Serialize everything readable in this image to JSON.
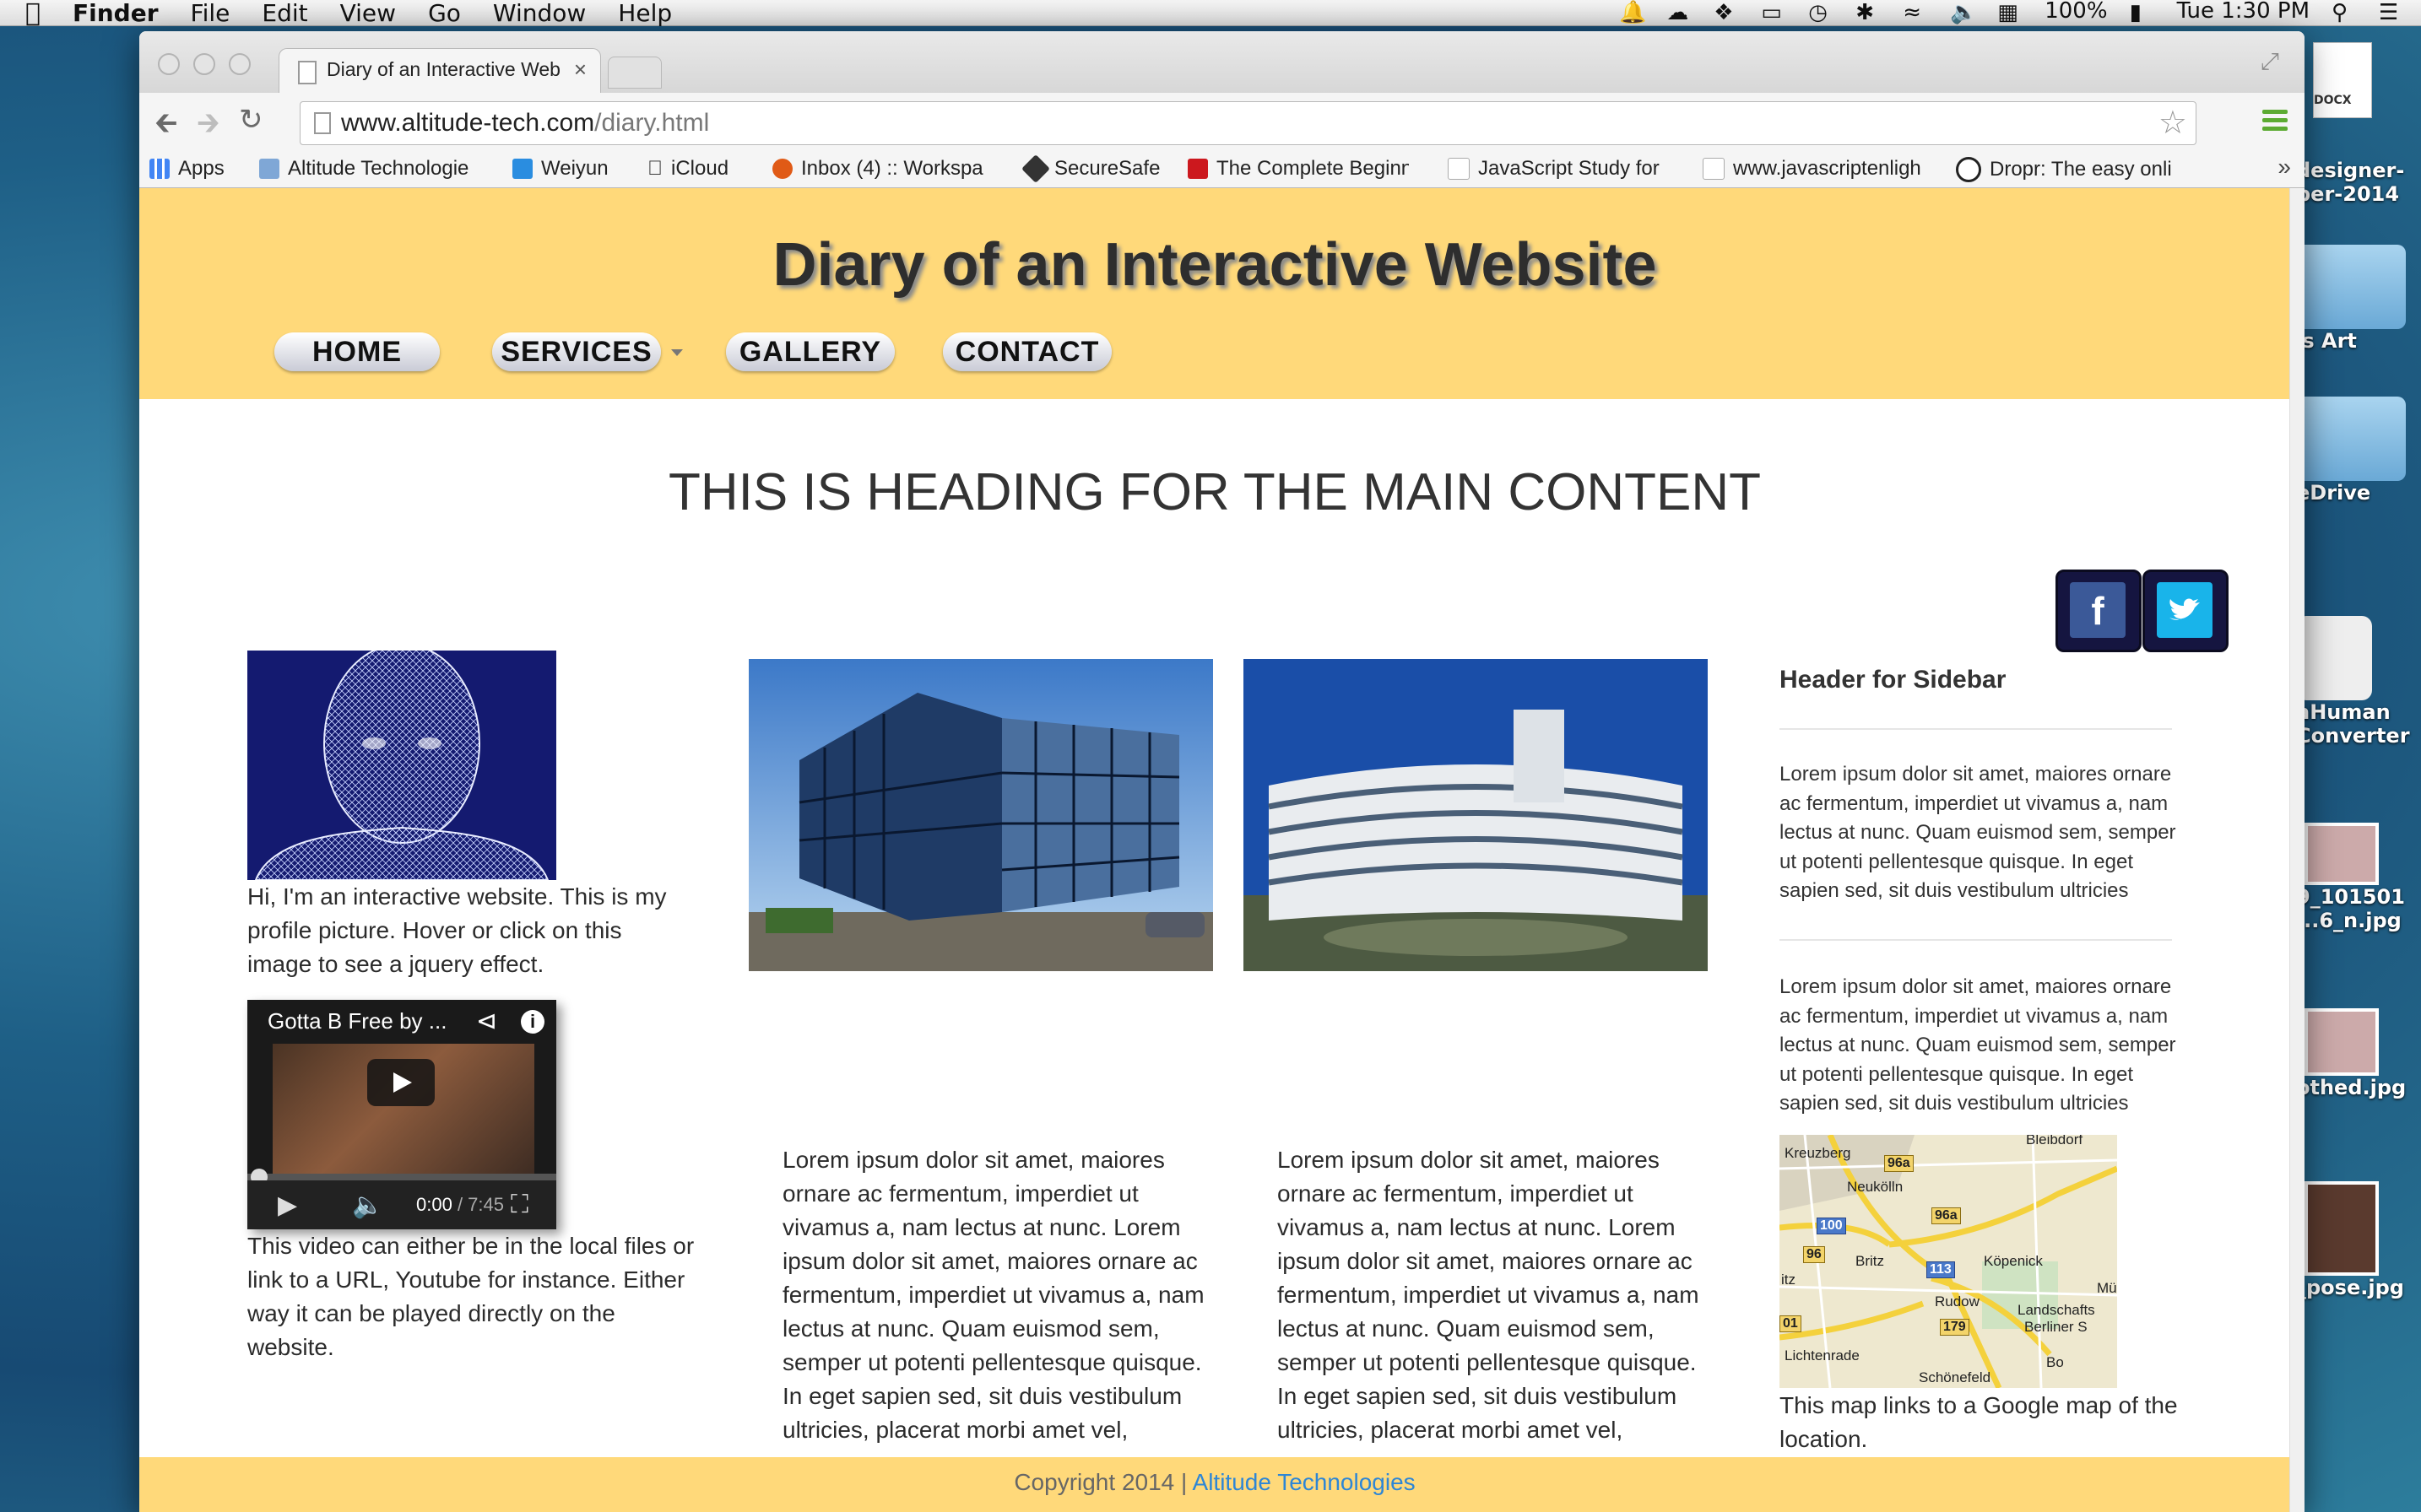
{
  "menubar": {
    "app_name": "Finder",
    "menus": [
      "File",
      "Edit",
      "View",
      "Go",
      "Window",
      "Help"
    ],
    "battery": "100%",
    "clock": "Tue 1:30 PM",
    "status_icons": [
      "notification-bell-icon",
      "creative-cloud-icon",
      "dropbox-icon",
      "airplay-icon",
      "time-machine-icon",
      "bluetooth-icon",
      "wifi-icon",
      "volume-icon",
      "input-source-icon",
      "battery-icon",
      "spotlight-icon",
      "notification-center-icon"
    ]
  },
  "desktop": {
    "items": [
      "designer-\nper-2014",
      "'s Art",
      "eDrive",
      "aHuman\nConverter",
      "9_101501\n...6_n.jpg",
      "othed.jpg",
      "_pose.jpg"
    ],
    "docx_label": "DOCX"
  },
  "browser": {
    "tab_title": "Diary of an Interactive Web",
    "tab_close": "×",
    "url_host": "www.altitude-tech.com",
    "url_path": "/diary.html",
    "bookmarks": [
      {
        "label": "Apps",
        "icon": "apps-grid-icon",
        "color": "#4285f4"
      },
      {
        "label": "Altitude Technologie",
        "icon": "folder-icon",
        "color": "#7fa7d6"
      },
      {
        "label": "Weiyun",
        "icon": "weiyun-icon",
        "color": "#2a8de0"
      },
      {
        "label": "iCloud",
        "icon": "apple-icon",
        "color": "#555555"
      },
      {
        "label": "Inbox (4) :: Workspa",
        "icon": "inbox-icon",
        "color": "#e05a16"
      },
      {
        "label": "SecureSafe",
        "icon": "securesafe-icon",
        "color": "#333333"
      },
      {
        "label": "The Complete Beginn",
        "icon": "youtube-icon",
        "color": "#cc181e"
      },
      {
        "label": "JavaScript Study for",
        "icon": "page-icon",
        "color": "#ffffff"
      },
      {
        "label": "www.javascriptenligh",
        "icon": "page-icon",
        "color": "#ffffff"
      },
      {
        "label": "Dropr: The easy onli",
        "icon": "dropr-icon",
        "color": "#222222"
      }
    ],
    "bookmarks_more": "»"
  },
  "site": {
    "title": "Diary of an Interactive Website",
    "nav": [
      {
        "label": "HOME"
      },
      {
        "label": "SERVICES",
        "has_dropdown": true
      },
      {
        "label": "GALLERY"
      },
      {
        "label": "CONTACT"
      }
    ],
    "main_heading": "THIS IS HEADING FOR THE MAIN CONTENT",
    "social": [
      {
        "label": "f",
        "color": "#3b5998"
      },
      {
        "label": "twitter",
        "color": "#19b4ea"
      }
    ],
    "profile_text": "Hi, I'm an interactive website. This is my profile picture. Hover or click on this image to see a jquery effect.",
    "video": {
      "title": "Gotta B Free by ...",
      "time_current": "0:00",
      "time_total": " / 7:45",
      "progress": 0
    },
    "video_text": "This video can either be in the local files or link to a URL, Youtube for instance. Either way it can be played directly on the website.",
    "column_text_1": "Lorem ipsum dolor sit amet, maiores ornare ac fermentum, imperdiet ut vivamus a, nam lectus at nunc. Lorem ipsum dolor sit amet, maiores ornare ac fermentum, imperdiet ut vivamus a, nam lectus at nunc. Quam euismod sem, semper ut potenti pellentesque quisque. In eget sapien sed, sit duis vestibulum ultricies, placerat morbi amet vel,",
    "column_text_2": "Lorem ipsum dolor sit amet, maiores ornare ac fermentum, imperdiet ut vivamus a, nam lectus at nunc. Lorem ipsum dolor sit amet, maiores ornare ac fermentum, imperdiet ut vivamus a, nam lectus at nunc. Quam euismod sem, semper ut potenti pellentesque quisque. In eget sapien sed, sit duis vestibulum ultricies, placerat morbi amet vel,",
    "sidebar": {
      "header": "Header for Sidebar",
      "text_1": "Lorem ipsum dolor sit amet, maiores ornare ac fermentum, imperdiet ut vivamus a, nam lectus at nunc. Quam euismod sem, semper ut potenti pellentesque quisque. In eget sapien sed, sit duis vestibulum ultricies",
      "text_2": "Lorem ipsum dolor sit amet, maiores ornare ac fermentum, imperdiet ut vivamus a, nam lectus at nunc. Quam euismod sem, semper ut potenti pellentesque quisque. In eget sapien sed, sit duis vestibulum ultricies",
      "map_labels": [
        "Kreuzberg",
        "Neukölln",
        "Britz",
        "Rudow",
        "Köpenick",
        "Landschafts",
        "Berliner S",
        "Lichtenrade",
        "Schönefeld",
        "itz",
        "Bo",
        "Mü",
        "Bleibdorf"
      ],
      "map_routes": [
        "96a",
        "100",
        "96a",
        "96",
        "113",
        "179",
        "01"
      ],
      "map_text": "This map links to a Google map of the location."
    },
    "footer_text": "Copyright 2014 | ",
    "footer_link": "Altitude Technologies",
    "accent_color": "#ffd97a"
  }
}
